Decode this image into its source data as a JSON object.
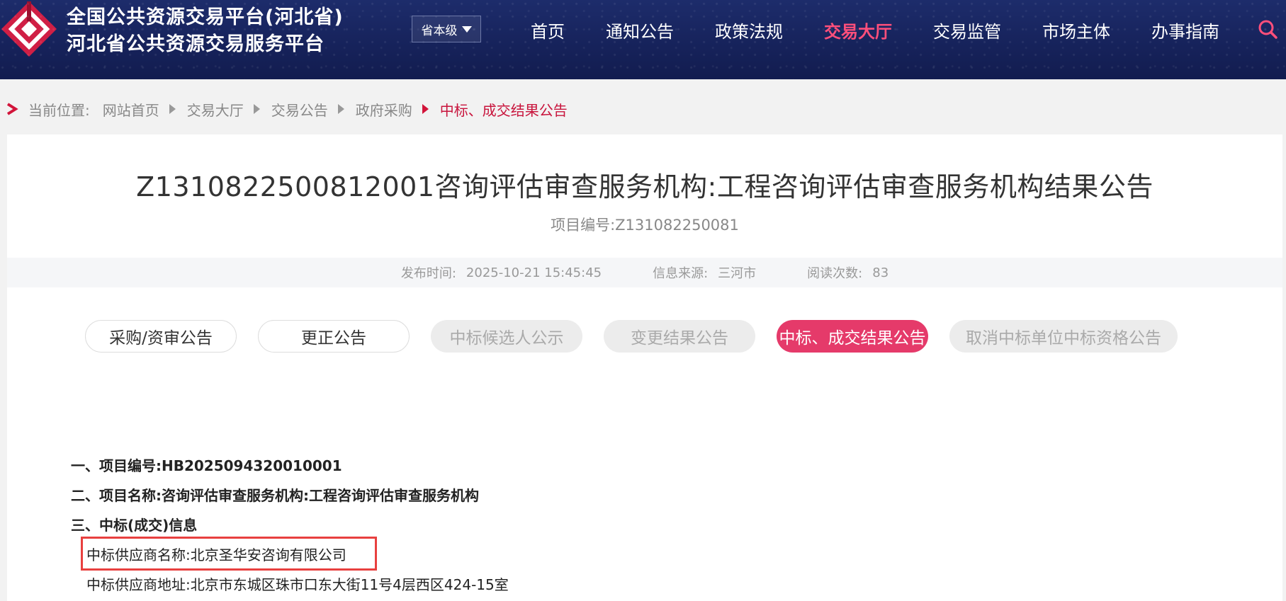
{
  "header": {
    "title_line1": "全国公共资源交易平台(河北省)",
    "title_line2": "河北省公共资源交易服务平台",
    "level_select": "省本级",
    "nav": [
      "首页",
      "通知公告",
      "政策法规",
      "交易大厅",
      "交易监管",
      "市场主体",
      "办事指南"
    ],
    "active_nav": "交易大厅",
    "accent_color": "#ff4f7b",
    "background_color": "#16225a"
  },
  "breadcrumb": {
    "prefix": "当前位置:",
    "items": [
      "网站首页",
      "交易大厅",
      "交易公告",
      "政府采购"
    ],
    "current": "中标、成交结果公告"
  },
  "article": {
    "title": "Z1310822500812001咨询评估审查服务机构:工程咨询评估审查服务机构结果公告",
    "project_code": "项目编号:Z131082250081",
    "meta": {
      "publish_label": "发布时间:",
      "publish_time": "2025-10-21 15:45:45",
      "source_label": "信息来源:",
      "source": "三河市",
      "reads_label": "阅读次数:",
      "reads": "83"
    },
    "tabs": [
      {
        "label": "采购/资审公告",
        "state": "normal"
      },
      {
        "label": "更正公告",
        "state": "normal"
      },
      {
        "label": "中标候选人公示",
        "state": "disabled"
      },
      {
        "label": "变更结果公告",
        "state": "disabled"
      },
      {
        "label": "中标、成交结果公告",
        "state": "active"
      },
      {
        "label": "取消中标单位中标资格公告",
        "state": "disabled"
      }
    ],
    "content": {
      "line1": "一、项目编号:HB2025094320010001",
      "line2": "二、项目名称:咨询评估审查服务机构:工程咨询评估审查服务机构",
      "line3": "三、中标(成交)信息",
      "supplier_name": "中标供应商名称:北京圣华安咨询有限公司",
      "supplier_address": "中标供应商地址:北京市东城区珠市口东大街11号4层西区424-15室"
    }
  }
}
